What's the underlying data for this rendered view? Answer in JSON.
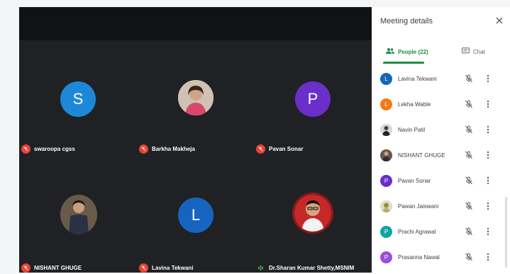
{
  "stage": {
    "tiles": [
      {
        "name": "swaroopa cgss",
        "initial": "S",
        "color": "#1e88d8"
      },
      {
        "name": "Barkha Makheja"
      },
      {
        "name": "Pavan Sonar",
        "initial": "P",
        "color": "#6a2fc9"
      },
      {
        "name": "NISHANT GHUGE"
      },
      {
        "name": "Lavina Tekwani",
        "initial": "L",
        "color": "#1565c0"
      },
      {
        "name": "Dr.Sharan Kumar Shetty,MSNIM"
      }
    ]
  },
  "panel": {
    "title": "Meeting details",
    "people_tab": "People (22)",
    "chat_tab": "Chat",
    "participants": [
      {
        "name": "Lavina Tekwani",
        "initial": "L",
        "color": "#1565c0"
      },
      {
        "name": "Lekha Wable",
        "initial": "L",
        "color": "#ef7c1a"
      },
      {
        "name": "Navin Patil"
      },
      {
        "name": "NISHANT GHUGE"
      },
      {
        "name": "Pavan Sonar",
        "initial": "P",
        "color": "#6a2fc9"
      },
      {
        "name": "Pawan Jaiswani"
      },
      {
        "name": "Prachi Agrawal",
        "initial": "P",
        "color": "#12a4a4"
      },
      {
        "name": "Prasanna Nawal",
        "initial": "P",
        "color": "#9c4fd6"
      }
    ]
  },
  "colors": {
    "accent": "#1e8e3e",
    "mute": "#ea4335",
    "stage": "#202124"
  }
}
